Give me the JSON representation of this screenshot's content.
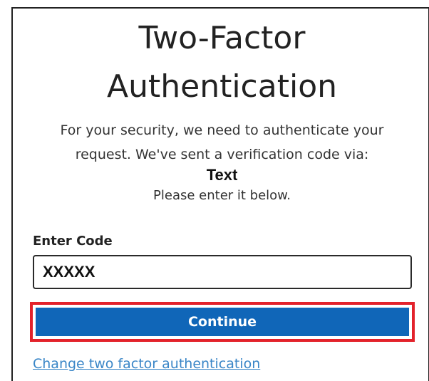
{
  "heading": {
    "line1": "Two-Factor",
    "line2": "Authentication"
  },
  "message": {
    "line1": "For your security, we need to authenticate your",
    "line2": "request. We've sent a verification code via:",
    "method": "Text",
    "line3": "Please enter it below."
  },
  "form": {
    "code_label": "Enter Code",
    "code_value": "XXXXX"
  },
  "actions": {
    "continue_label": "Continue",
    "change_link": "Change two factor authentication"
  },
  "colors": {
    "button_bg": "#1066b8",
    "highlight_border": "#e3222b",
    "link": "#3a86c7"
  }
}
